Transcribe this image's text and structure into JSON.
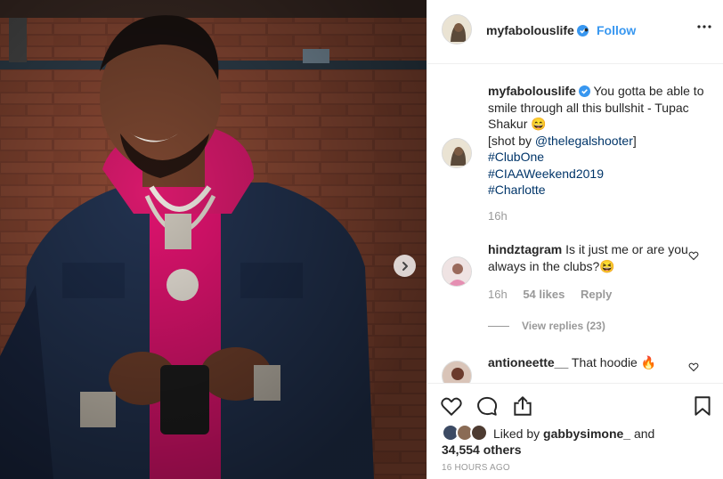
{
  "post": {
    "username": "myfabolouslife",
    "follow_label": "Follow",
    "separator": "•"
  },
  "caption": {
    "username": "myfabolouslife",
    "text": "You gotta be able to smile through all this bullshit - Tupac Shakur 😄",
    "shot_by_prefix": "[shot by ",
    "shot_by_handle": "@thelegalshooter",
    "shot_by_suffix": "]",
    "hashtags": [
      "#ClubOne",
      "#CIAAWeekend2019",
      "#Charlotte"
    ],
    "time": "16h"
  },
  "comments": [
    {
      "username": "hindztagram",
      "text": "Is it just me or are you always in the clubs?😆",
      "time": "16h",
      "likes": "54 likes",
      "reply_label": "Reply",
      "view_replies": "View replies (23)"
    },
    {
      "username": "antioneette__",
      "text": "That hoodie 🔥"
    }
  ],
  "likes": {
    "prefix": "Liked by ",
    "user": "gabbysimone_",
    "middle": " and",
    "others": "34,554 others"
  },
  "timestamp": "16 HOURS AGO",
  "icons": [
    "verified-badge-icon",
    "more-options-icon",
    "heart-icon",
    "comment-icon",
    "share-icon",
    "bookmark-icon",
    "chevron-right-icon"
  ],
  "colors": {
    "link": "#003569",
    "follow": "#3897f0",
    "muted": "#999999"
  }
}
